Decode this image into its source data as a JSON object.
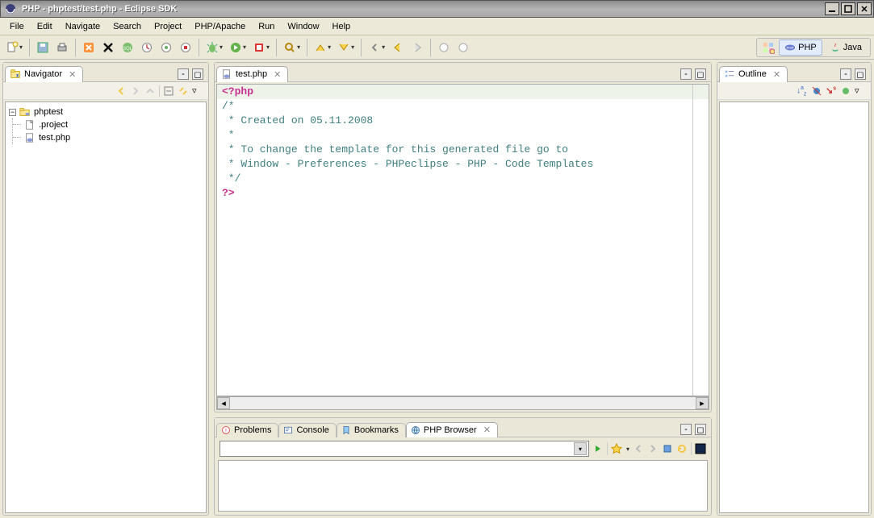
{
  "window": {
    "title": "PHP - phptest/test.php - Eclipse SDK"
  },
  "menu": {
    "items": [
      "File",
      "Edit",
      "Navigate",
      "Search",
      "Project",
      "PHP/Apache",
      "Run",
      "Window",
      "Help"
    ]
  },
  "perspectives": {
    "php": "PHP",
    "java": "Java"
  },
  "navigator": {
    "title": "Navigator",
    "project": "phptest",
    "files": [
      ".project",
      "test.php"
    ]
  },
  "editor": {
    "tab": "test.php",
    "lines_open": "<?php",
    "lines": [
      "/*",
      " * Created on 05.11.2008",
      " *",
      " * To change the template for this generated file go to",
      " * Window - Preferences - PHPeclipse - PHP - Code Templates",
      " */"
    ],
    "lines_close": "?>"
  },
  "outline": {
    "title": "Outline"
  },
  "bottom": {
    "tabs": [
      "Problems",
      "Console",
      "Bookmarks",
      "PHP Browser"
    ]
  }
}
